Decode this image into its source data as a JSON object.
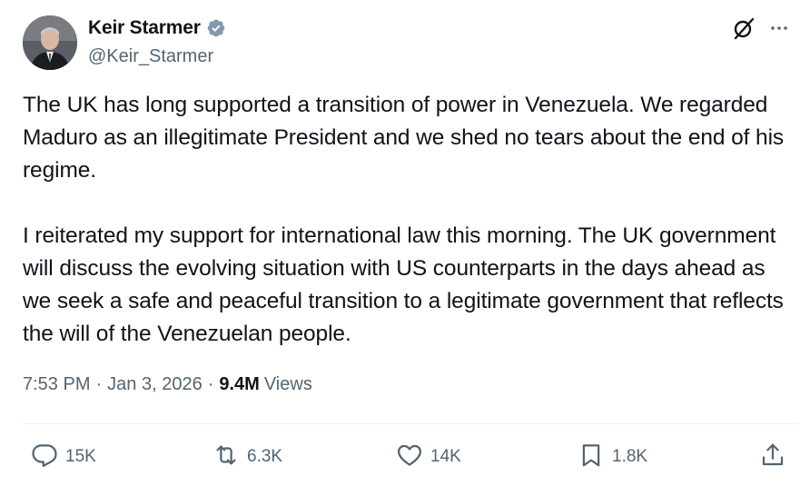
{
  "author": {
    "display_name": "Keir Starmer",
    "handle": "@Keir_Starmer",
    "verified_icon": "verified-badge-icon",
    "verified_color": "#829aab"
  },
  "tweet": {
    "paragraphs": [
      "The UK has long supported a transition of power in Venezuela. We regarded Maduro as an illegitimate President and we shed no tears about the end of his regime.",
      "I reiterated my support for international law this morning. The UK government will discuss the evolving situation with US counterparts in the days ahead as we seek a safe and peaceful transition to a legitimate government that reflects the will of the Venezuelan people."
    ],
    "time": "7:53 PM",
    "date": "Jan 3, 2026",
    "separator": "·",
    "views_count": "9.4M",
    "views_label": "Views"
  },
  "actions": {
    "reply": {
      "icon": "reply-icon",
      "count": "15K"
    },
    "repost": {
      "icon": "repost-icon",
      "count": "6.3K"
    },
    "like": {
      "icon": "heart-icon",
      "count": "14K"
    },
    "bookmark": {
      "icon": "bookmark-icon",
      "count": "1.8K"
    },
    "share": {
      "icon": "share-icon"
    }
  },
  "colors": {
    "text_primary": "#0f1419",
    "text_secondary": "#536471",
    "divider": "#eff3f4"
  }
}
